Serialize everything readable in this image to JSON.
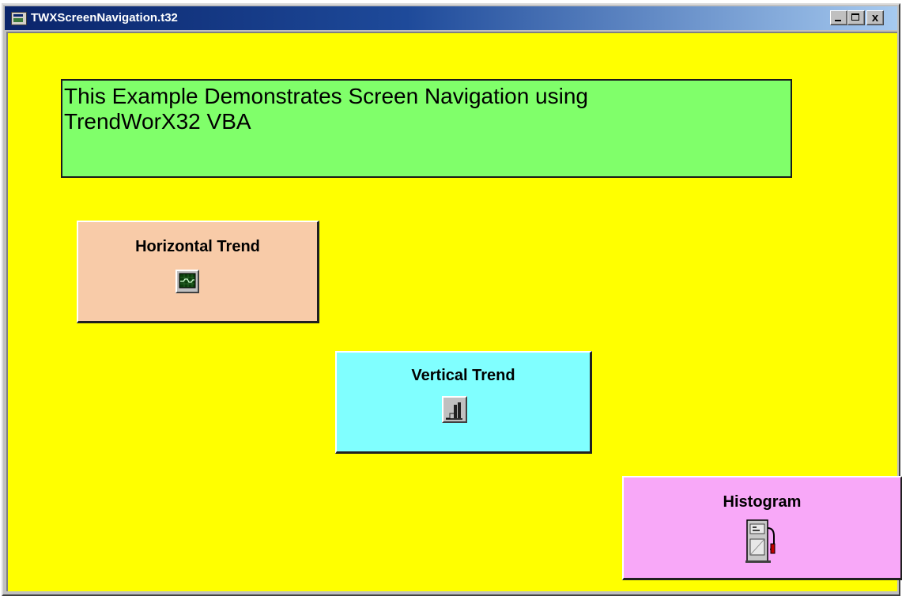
{
  "window": {
    "title": "TWXScreenNavigation.t32",
    "controls": {
      "minimize": "minimize",
      "maximize": "maximize",
      "close": "x"
    }
  },
  "panel": {
    "text": "This Example Demonstrates Screen Navigation using\nTrendWorX32 VBA"
  },
  "buttons": {
    "horizontal": {
      "label": "Horizontal Trend",
      "icon": "trend-monitor-icon"
    },
    "vertical": {
      "label": "Vertical Trend",
      "icon": "vertical-trend-icon"
    },
    "histogram": {
      "label": "Histogram",
      "icon": "fuel-pump-icon"
    }
  },
  "colors": {
    "background": "#ffff00",
    "panel": "#80ff6a",
    "horizontal_button": "#f8cba8",
    "vertical_button": "#80ffff",
    "histogram_button": "#f8a8f8"
  }
}
